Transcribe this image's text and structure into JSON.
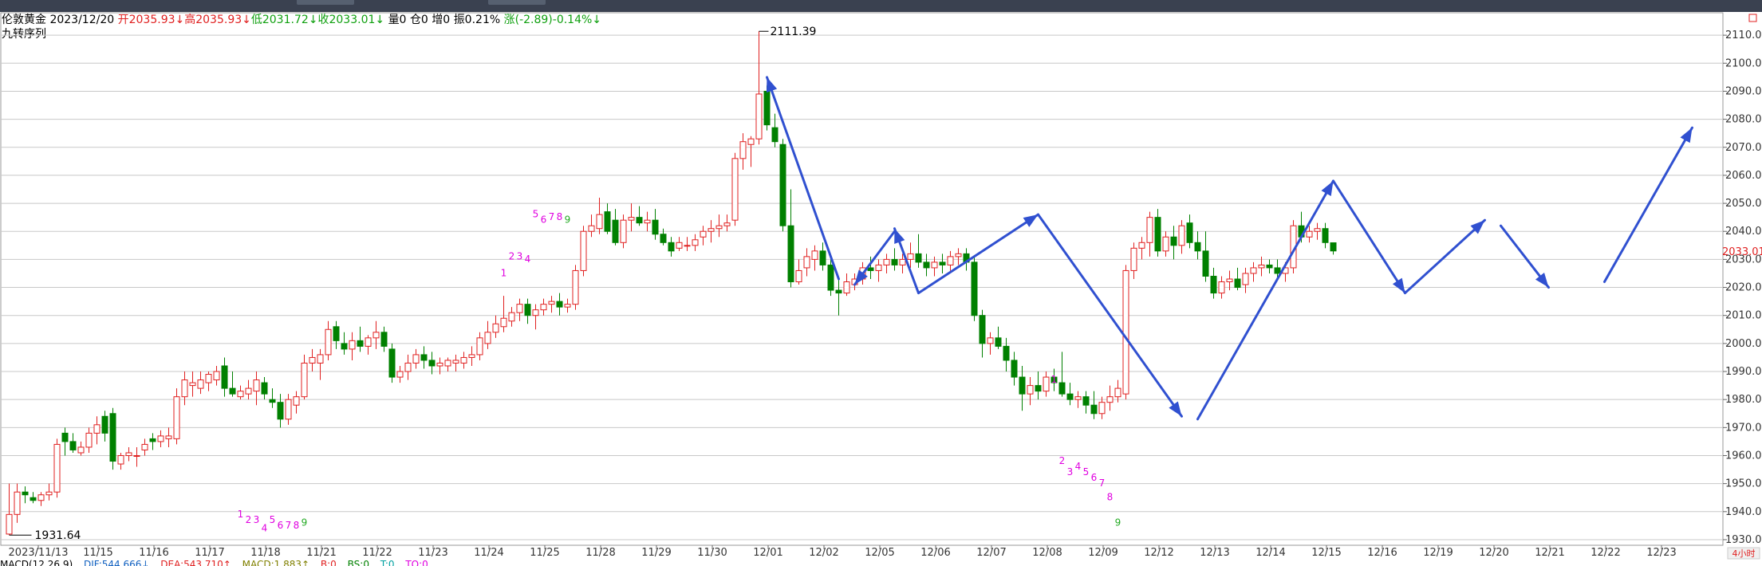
{
  "header": {
    "symbol": "伦敦黄金",
    "date": "2023/12/20",
    "open": "开2035.93↓",
    "high": "高2035.93↓",
    "low": "低2031.72↓",
    "close": "收2033.01↓",
    "volume": "量0",
    "position": "仓0",
    "increase": "增0",
    "amplitude": "振0.21%",
    "change": "涨(-2.89)-0.14%↓"
  },
  "indicator_label": "九转序列",
  "footer": {
    "macd": "MACD(12,26,9)",
    "dif": "DIF:544.666↓",
    "dea": "DEA:543.710↑",
    "macd_val": "MACD:1.883↑",
    "b": "B:0",
    "bs": "BS:0",
    "ts": "T:0",
    "tq": "TQ:0"
  },
  "colors": {
    "up": "#e02020",
    "down": "#008000",
    "arrow": "#3050d0",
    "seq_up": "#e000e0",
    "seq_9": "#22aa22",
    "grid": "#c8c8c8",
    "current": "#e02020"
  },
  "chart_data": {
    "type": "candlestick",
    "ylim": [
      1928,
      2118
    ],
    "y_ticks": [
      1930,
      1940,
      1950,
      1960,
      1970,
      1980,
      1990,
      2000,
      2010,
      2020,
      2030,
      2040,
      2050,
      2060,
      2070,
      2080,
      2090,
      2100,
      2110
    ],
    "y_tick_labels": [
      "1930.00",
      "1940.00",
      "1950.00",
      "1960.00",
      "1970.00",
      "1980.00",
      "1990.00",
      "2000.00",
      "2010.00",
      "2020.00",
      "2030.00",
      "2040.00",
      "2050.00",
      "2060.00",
      "2070.00",
      "2080.00",
      "2090.00",
      "2100.00",
      "2110.00"
    ],
    "current_price": 2033.01,
    "current_label": "2033.01",
    "max_label": "2111.39",
    "min_label": "1931.64",
    "x_labels": [
      "2023/11/13",
      "11/15",
      "11/16",
      "11/17",
      "11/18",
      "11/21",
      "11/22",
      "11/23",
      "11/24",
      "11/25",
      "11/28",
      "11/29",
      "11/30",
      "12/01",
      "12/02",
      "12/05",
      "12/06",
      "12/07",
      "12/08",
      "12/09",
      "12/12",
      "12/13",
      "12/14",
      "12/15",
      "12/16",
      "12/19",
      "12/20",
      "12/21",
      "12/22",
      "12/23"
    ],
    "ohlc": [
      [
        1932,
        1950,
        1931.64,
        1939
      ],
      [
        1939,
        1950,
        1936,
        1947
      ],
      [
        1947,
        1949,
        1943,
        1946
      ],
      [
        1945,
        1947,
        1943,
        1944
      ],
      [
        1944,
        1947,
        1942,
        1946
      ],
      [
        1946,
        1950,
        1944,
        1947
      ],
      [
        1947,
        1966,
        1945,
        1964
      ],
      [
        1968,
        1970,
        1960,
        1965
      ],
      [
        1965,
        1968,
        1961,
        1962
      ],
      [
        1961,
        1965,
        1960,
        1963
      ],
      [
        1963,
        1970,
        1961,
        1968
      ],
      [
        1968,
        1974,
        1964,
        1971
      ],
      [
        1974,
        1976,
        1965,
        1968
      ],
      [
        1975,
        1977,
        1955,
        1958
      ],
      [
        1957,
        1961,
        1955,
        1960
      ],
      [
        1960,
        1963,
        1958,
        1961
      ],
      [
        1960,
        1963,
        1956,
        1960
      ],
      [
        1962,
        1966,
        1960,
        1964
      ],
      [
        1966,
        1968,
        1962,
        1965
      ],
      [
        1965,
        1969,
        1963,
        1967
      ],
      [
        1966,
        1970,
        1963,
        1967
      ],
      [
        1966,
        1984,
        1964,
        1981
      ],
      [
        1981,
        1990,
        1978,
        1987
      ],
      [
        1985,
        1990,
        1981,
        1986
      ],
      [
        1984,
        1990,
        1982,
        1987
      ],
      [
        1986,
        1990,
        1983,
        1989
      ],
      [
        1987,
        1992,
        1985,
        1990
      ],
      [
        1992,
        1995,
        1981,
        1984
      ],
      [
        1984,
        1990,
        1981,
        1982
      ],
      [
        1981,
        1985,
        1980,
        1983
      ],
      [
        1982,
        1987,
        1980,
        1984
      ],
      [
        1983,
        1990,
        1978,
        1987
      ],
      [
        1986,
        1988,
        1980,
        1982
      ],
      [
        1980,
        1984,
        1977,
        1979
      ],
      [
        1979,
        1982,
        1970,
        1973
      ],
      [
        1973,
        1982,
        1971,
        1980
      ],
      [
        1978,
        1983,
        1975,
        1981
      ],
      [
        1981,
        1996,
        1980,
        1993
      ],
      [
        1993,
        1998,
        1990,
        1995
      ],
      [
        1993,
        1998,
        1987,
        1996
      ],
      [
        1996,
        2008,
        1994,
        2005
      ],
      [
        2006,
        2008,
        1998,
        2001
      ],
      [
        2000,
        2004,
        1996,
        1998
      ],
      [
        1998,
        2004,
        1994,
        2001
      ],
      [
        2001,
        2006,
        1997,
        1999
      ],
      [
        1999,
        2003,
        1996,
        2002
      ],
      [
        2002,
        2008,
        1998,
        2004
      ],
      [
        2004,
        2006,
        1997,
        1999
      ],
      [
        1998,
        2000,
        1986,
        1988
      ],
      [
        1988,
        1992,
        1986,
        1990
      ],
      [
        1990,
        1996,
        1987,
        1993
      ],
      [
        1993,
        1998,
        1991,
        1996
      ],
      [
        1996,
        1999,
        1991,
        1994
      ],
      [
        1994,
        1997,
        1989,
        1992
      ],
      [
        1992,
        1995,
        1989,
        1993
      ],
      [
        1992,
        1995,
        1990,
        1994
      ],
      [
        1993,
        1996,
        1990,
        1994
      ],
      [
        1993,
        1997,
        1991,
        1995
      ],
      [
        1995,
        1999,
        1992,
        1996
      ],
      [
        1996,
        2004,
        1994,
        2002
      ],
      [
        2000,
        2008,
        1998,
        2004
      ],
      [
        2004,
        2010,
        2002,
        2007
      ],
      [
        2006,
        2017,
        2004,
        2009
      ],
      [
        2008,
        2013,
        2006,
        2011
      ],
      [
        2011,
        2016,
        2008,
        2014
      ],
      [
        2014,
        2016,
        2007,
        2010
      ],
      [
        2010,
        2014,
        2005,
        2012
      ],
      [
        2012,
        2016,
        2010,
        2014
      ],
      [
        2014,
        2017,
        2011,
        2015
      ],
      [
        2015,
        2018,
        2010,
        2013
      ],
      [
        2013,
        2016,
        2011,
        2014
      ],
      [
        2014,
        2028,
        2012,
        2026
      ],
      [
        2026,
        2042,
        2024,
        2040
      ],
      [
        2040,
        2046,
        2038,
        2042
      ],
      [
        2041,
        2052,
        2039,
        2046
      ],
      [
        2047,
        2050,
        2039,
        2040
      ],
      [
        2044,
        2048,
        2035,
        2036
      ],
      [
        2036,
        2046,
        2034,
        2044
      ],
      [
        2044,
        2050,
        2040,
        2045
      ],
      [
        2045,
        2049,
        2042,
        2043
      ],
      [
        2043,
        2047,
        2040,
        2044
      ],
      [
        2044,
        2048,
        2037,
        2039
      ],
      [
        2039,
        2041,
        2035,
        2036
      ],
      [
        2036,
        2038,
        2031,
        2033
      ],
      [
        2034,
        2038,
        2033,
        2036
      ],
      [
        2035,
        2038,
        2033,
        2035
      ],
      [
        2035,
        2039,
        2033,
        2037
      ],
      [
        2038,
        2042,
        2035,
        2040
      ],
      [
        2040,
        2044,
        2036,
        2041
      ],
      [
        2041,
        2046,
        2038,
        2042
      ],
      [
        2042,
        2046,
        2040,
        2043
      ],
      [
        2044,
        2068,
        2042,
        2066
      ],
      [
        2066,
        2075,
        2062,
        2072
      ],
      [
        2071,
        2074,
        2063,
        2073
      ],
      [
        2073,
        2111.39,
        2071,
        2089
      ],
      [
        2090,
        2092,
        2076,
        2078
      ],
      [
        2077,
        2082,
        2070,
        2072
      ],
      [
        2071,
        2073,
        2040,
        2042
      ],
      [
        2042,
        2055,
        2020,
        2022
      ],
      [
        2022,
        2030,
        2021,
        2026
      ],
      [
        2027,
        2034,
        2024,
        2031
      ],
      [
        2030,
        2035,
        2026,
        2033
      ],
      [
        2033,
        2036,
        2026,
        2028
      ],
      [
        2028,
        2030,
        2017,
        2019
      ],
      [
        2019,
        2023,
        2010,
        2018
      ],
      [
        2018,
        2025,
        2017,
        2022
      ],
      [
        2021,
        2025,
        2019,
        2023
      ],
      [
        2023,
        2029,
        2021,
        2027
      ],
      [
        2027,
        2031,
        2023,
        2026
      ],
      [
        2026,
        2030,
        2022,
        2028
      ],
      [
        2028,
        2032,
        2025,
        2030
      ],
      [
        2030,
        2034,
        2026,
        2028
      ],
      [
        2028,
        2032,
        2025,
        2030
      ],
      [
        2030,
        2036,
        2027,
        2032
      ],
      [
        2032,
        2039,
        2027,
        2029
      ],
      [
        2029,
        2032,
        2024,
        2027
      ],
      [
        2027,
        2031,
        2024,
        2029
      ],
      [
        2029,
        2032,
        2025,
        2028
      ],
      [
        2028,
        2033,
        2026,
        2031
      ],
      [
        2031,
        2034,
        2028,
        2032
      ],
      [
        2032,
        2034,
        2026,
        2029
      ],
      [
        2029,
        2031,
        2008,
        2010
      ],
      [
        2010,
        2012,
        1995,
        2000
      ],
      [
        2000,
        2004,
        1996,
        2002
      ],
      [
        2002,
        2006,
        1998,
        1999
      ],
      [
        1999,
        2002,
        1990,
        1994
      ],
      [
        1994,
        1997,
        1985,
        1988
      ],
      [
        1988,
        1992,
        1976,
        1982
      ],
      [
        1982,
        1988,
        1978,
        1985
      ],
      [
        1985,
        1990,
        1980,
        1983
      ],
      [
        1983,
        1990,
        1981,
        1988
      ],
      [
        1988,
        1991,
        1983,
        1986
      ],
      [
        1986,
        1997,
        1981,
        1982
      ],
      [
        1982,
        1986,
        1978,
        1980
      ],
      [
        1980,
        1983,
        1977,
        1981
      ],
      [
        1981,
        1983,
        1975,
        1978
      ],
      [
        1978,
        1983,
        1973,
        1975
      ],
      [
        1975,
        1981,
        1973,
        1979
      ],
      [
        1979,
        1985,
        1976,
        1981
      ],
      [
        1981,
        1987,
        1979,
        1984
      ],
      [
        1982,
        2028,
        1980,
        2026
      ],
      [
        2026,
        2036,
        2023,
        2034
      ],
      [
        2034,
        2038,
        2030,
        2036
      ],
      [
        2036,
        2047,
        2031,
        2045
      ],
      [
        2045,
        2048,
        2031,
        2033
      ],
      [
        2033,
        2040,
        2031,
        2038
      ],
      [
        2038,
        2042,
        2030,
        2035
      ],
      [
        2035,
        2044,
        2032,
        2042
      ],
      [
        2043,
        2046,
        2034,
        2036
      ],
      [
        2036,
        2040,
        2030,
        2033
      ],
      [
        2033,
        2040,
        2022,
        2024
      ],
      [
        2024,
        2027,
        2016,
        2018
      ],
      [
        2018,
        2024,
        2016,
        2022
      ],
      [
        2022,
        2026,
        2019,
        2023
      ],
      [
        2023,
        2027,
        2019,
        2020
      ],
      [
        2021,
        2027,
        2018,
        2025
      ],
      [
        2025,
        2029,
        2022,
        2027
      ],
      [
        2027,
        2031,
        2024,
        2028
      ],
      [
        2028,
        2030,
        2025,
        2027
      ],
      [
        2027,
        2030,
        2023,
        2025
      ],
      [
        2025,
        2029,
        2022,
        2027
      ],
      [
        2027,
        2044,
        2025,
        2042
      ],
      [
        2042,
        2047,
        2036,
        2038
      ],
      [
        2038,
        2042,
        2036,
        2040
      ],
      [
        2040,
        2043,
        2037,
        2041
      ],
      [
        2041,
        2043,
        2034,
        2036
      ],
      [
        2035.93,
        2035.93,
        2031.72,
        2033.01
      ]
    ],
    "td_sequences": [
      {
        "start": 29,
        "labels": [
          "1",
          "2",
          "3",
          "4",
          "5",
          "6",
          "7",
          "8",
          "9"
        ],
        "values": [
          1938,
          1936,
          1936,
          1933,
          1936,
          1934,
          1934,
          1934,
          1935
        ]
      },
      {
        "start": 62,
        "labels": [
          "1",
          "2",
          "3",
          "4",
          "5",
          "6",
          "7",
          "8",
          "9"
        ],
        "values": [
          2024,
          2030,
          2030,
          2029,
          2045,
          2043,
          2044,
          2044,
          2043
        ]
      },
      {
        "start": 131,
        "labels": [
          "1",
          "2",
          "3",
          "4",
          "5",
          "6",
          "7",
          "8",
          "9"
        ],
        "values": [
          1986,
          1957,
          1953,
          1955,
          1953,
          1951,
          1949,
          1944,
          1935
        ]
      }
    ],
    "trend_lines": [
      {
        "x1": 104,
        "y1": 2023,
        "x2": 95,
        "y2": 2095
      },
      {
        "x1": 111,
        "y1": 2040,
        "x2": 106,
        "y2": 2021
      },
      {
        "x1": 114,
        "y1": 2018,
        "x2": 111,
        "y2": 2041
      },
      {
        "x1": 114,
        "y1": 2018,
        "x2": 129,
        "y2": 2046
      },
      {
        "x1": 129,
        "y1": 2046,
        "x2": 147,
        "y2": 1974
      },
      {
        "x1": 149,
        "y1": 1973,
        "x2": 166,
        "y2": 2058
      },
      {
        "x1": 166,
        "y1": 2058,
        "x2": 175,
        "y2": 2018
      },
      {
        "x1": 175,
        "y1": 2018,
        "x2": 185,
        "y2": 2044
      },
      {
        "x1": 187,
        "y1": 2042,
        "x2": 193,
        "y2": 2020
      },
      {
        "x1": 200,
        "y1": 2022,
        "x2": 211,
        "y2": 2077
      }
    ]
  }
}
